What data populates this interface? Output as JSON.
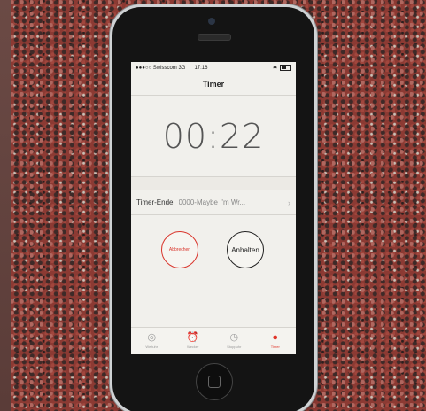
{
  "status_bar": {
    "carrier": "●●●○○ Swisscom 3G",
    "time": "17:16"
  },
  "nav_title": "Timer",
  "countdown": "00:22",
  "timer_end": {
    "label": "Timer-Ende",
    "value": "0000-Maybe I'm Wr...",
    "chevron": "›"
  },
  "buttons": {
    "cancel": "Abbrechen",
    "pause": "Anhalten"
  },
  "tabs": [
    {
      "label": "Weltuhr",
      "icon": "globe-icon"
    },
    {
      "label": "Wecker",
      "icon": "alarm-clock-icon"
    },
    {
      "label": "Stoppuhr",
      "icon": "stopwatch-icon"
    },
    {
      "label": "Timer",
      "icon": "timer-icon",
      "active": true
    }
  ],
  "colors": {
    "accent": "#e03328",
    "screen_bg": "#f1f0ec",
    "track": "#8c3a33"
  }
}
